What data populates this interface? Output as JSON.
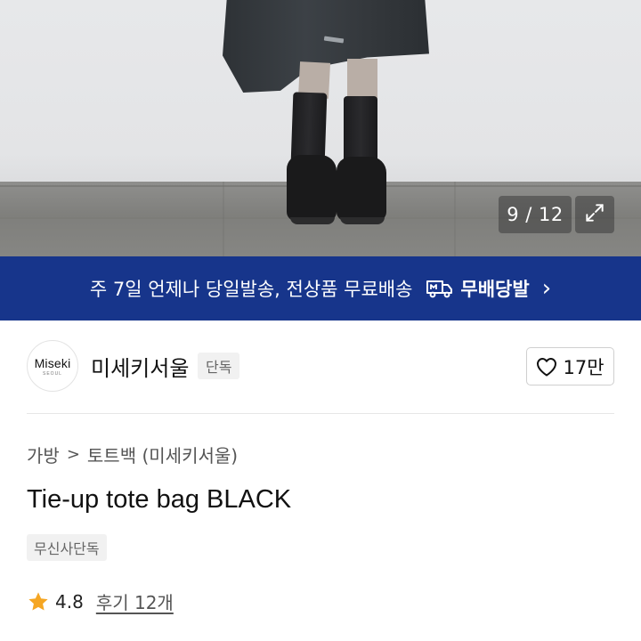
{
  "gallery": {
    "counter": "9 / 12",
    "expand_icon": "expand-icon"
  },
  "banner": {
    "text": "주 7일 언제나 당일발송, 전상품 무료배송",
    "service_label": "무배당발",
    "service_icon": "m-truck-icon",
    "chevron": "›",
    "color": "#17358b"
  },
  "store": {
    "logo_text": "Miseki",
    "logo_subtext": "SEOUL",
    "name": "미세키서울",
    "badge": "단독",
    "like_count": "17만",
    "like_icon": "heart-icon"
  },
  "product": {
    "breadcrumb": {
      "category": "가방",
      "separator": ">",
      "subcategory": "토트백 (미세키서울)"
    },
    "title": "Tie-up tote bag BLACK",
    "tag": "무신사단독",
    "rating": "4.8",
    "rating_icon": "star-icon",
    "star_color": "#f5a623",
    "review_label": "후기 12개"
  }
}
